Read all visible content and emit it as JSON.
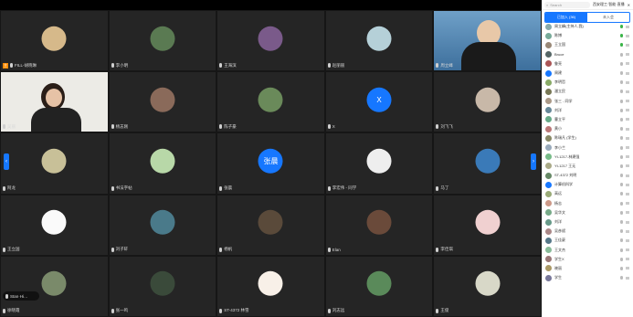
{
  "sidebar": {
    "search_placeholder": "Search",
    "meeting_name": "西安理工·智能·直播",
    "tab_active": "已加入 (36)",
    "tab_other": "未入会",
    "participants": [
      {
        "name": "周立峰(主持人,我)",
        "color": "#8aa"
      },
      {
        "name": "陈博",
        "color": "#7a9"
      },
      {
        "name": "王立国",
        "color": "#987"
      },
      {
        "name": "Bruce",
        "color": "#566"
      },
      {
        "name": "鲁亮",
        "color": "#a55"
      },
      {
        "name": "周建",
        "color": "#1677ff"
      },
      {
        "name": "李明哲",
        "color": "#8a6"
      },
      {
        "name": "潘立民",
        "color": "#775"
      },
      {
        "name": "张三 - 同学",
        "color": "#a98"
      },
      {
        "name": "刘洋",
        "color": "#689"
      },
      {
        "name": "曹立平",
        "color": "#6a8"
      },
      {
        "name": "黄小",
        "color": "#b77"
      },
      {
        "name": "陈瑞凡 (学生)",
        "color": "#886"
      },
      {
        "name": "李小兰",
        "color": "#9ab"
      },
      {
        "name": "Yt-1217-林建强",
        "color": "#7b8"
      },
      {
        "name": "Yt-1217 王无",
        "color": "#aa8"
      },
      {
        "name": "ST-4372 刘明",
        "color": "#686"
      },
      {
        "name": "计算机科学",
        "color": "#1677ff"
      },
      {
        "name": "高远",
        "color": "#9a7"
      },
      {
        "name": "杨志",
        "color": "#c98"
      },
      {
        "name": "吴华文",
        "color": "#7a8"
      },
      {
        "name": "刘洋",
        "color": "#698"
      },
      {
        "name": "吴彦斌",
        "color": "#a88"
      },
      {
        "name": "王佳豪",
        "color": "#578"
      },
      {
        "name": "王文杰",
        "color": "#8b9"
      },
      {
        "name": "学生X",
        "color": "#977"
      },
      {
        "name": "晓丽",
        "color": "#a96"
      },
      {
        "name": "学生",
        "color": "#779"
      }
    ]
  },
  "tiles": [
    {
      "name": "FILL-胡晓琳",
      "host": true,
      "avatar": "#d6b98a"
    },
    {
      "name": "李小明",
      "avatar": "#5a7a52"
    },
    {
      "name": "王海滨",
      "avatar": "#7a5a8a"
    },
    {
      "name": "赵丽丽",
      "avatar": "#b5d0d8"
    },
    {
      "name": "周立峰",
      "video": "host"
    },
    {
      "name": "吴丽",
      "video": "woman"
    },
    {
      "name": "杨志刚",
      "avatar": "#8a6a5a"
    },
    {
      "name": "陈子豪",
      "avatar": "#6a8a5a"
    },
    {
      "name": "X",
      "avatar": "blue"
    },
    {
      "name": "刘飞飞",
      "avatar": "#c8b8a8"
    },
    {
      "name": "阿龙",
      "avatar": "#c8c098"
    },
    {
      "name": "书法字帖",
      "avatar": "#b8d8a8"
    },
    {
      "name": "张晨",
      "avatar": "blue",
      "label": "张晨"
    },
    {
      "name": "李宏伟 - 同学",
      "avatar": "#eeeeee"
    },
    {
      "name": "马丁",
      "avatar": "#3a7ab8"
    },
    {
      "name": "王立国",
      "avatar": "#fafafa"
    },
    {
      "name": "刘子轩",
      "avatar": "#4a7a8a"
    },
    {
      "name": "杨帆",
      "avatar": "#5a4a3a"
    },
    {
      "name": "Elan",
      "avatar": "#6a4a3a"
    },
    {
      "name": "李佳琪",
      "avatar": "#f0d0d0"
    },
    {
      "name": "徐晓霞",
      "avatar": "#7a8a6a"
    },
    {
      "name": "张一鸣",
      "avatar": "#3a4a3a"
    },
    {
      "name": "ST-4372 林雪",
      "avatar": "#f8f0e8"
    },
    {
      "name": "刘志远",
      "avatar": "#5a8a5a"
    },
    {
      "name": "王俊",
      "avatar": "#d8d8c8"
    }
  ],
  "mini_control": {
    "label": "Stan·Hi…"
  }
}
